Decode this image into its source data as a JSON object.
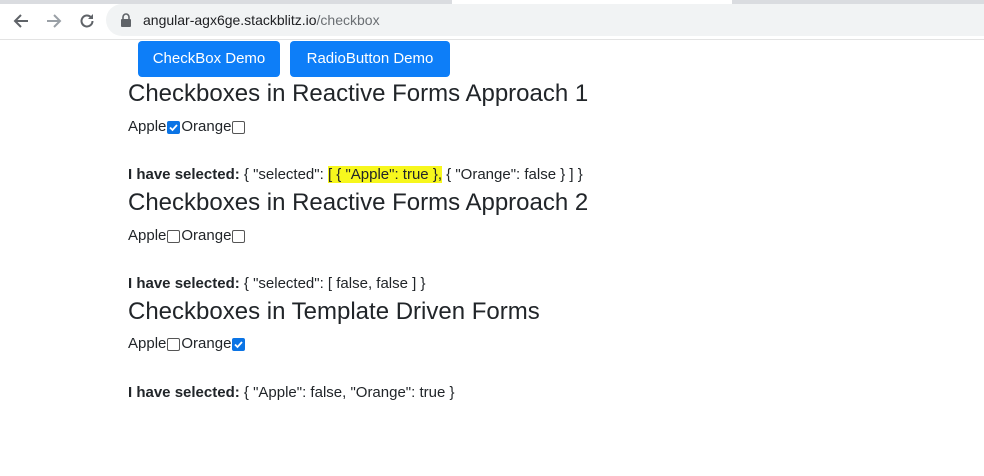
{
  "browser": {
    "url_host": "angular-agx6ge.stackblitz.io",
    "url_path": "/checkbox"
  },
  "nav": {
    "checkbox_demo": "CheckBox Demo",
    "radiobutton_demo": "RadioButton Demo"
  },
  "sections": [
    {
      "title": "Checkboxes in Reactive Forms Approach 1",
      "options": [
        {
          "label": "Apple",
          "checked": true
        },
        {
          "label": "Orange",
          "checked": false
        }
      ],
      "result_label": "I have selected:",
      "result_pre": " { \"selected\": ",
      "result_highlight": "[ { \"Apple\": true },",
      "result_post": " { \"Orange\": false } ] }",
      "highlight_color": "#f7f71d"
    },
    {
      "title": "Checkboxes in Reactive Forms Approach 2",
      "options": [
        {
          "label": "Apple",
          "checked": false
        },
        {
          "label": "Orange",
          "checked": false
        }
      ],
      "result_label": "I have selected:",
      "result_text": " { \"selected\": [ false, false ] }"
    },
    {
      "title": "Checkboxes in Template Driven Forms",
      "options": [
        {
          "label": "Apple",
          "checked": false
        },
        {
          "label": "Orange",
          "checked": true
        }
      ],
      "result_label": "I have selected:",
      "result_text": " { \"Apple\": false, \"Orange\": true }"
    }
  ],
  "colors": {
    "button_bg": "#0d7ef8",
    "checkbox_checked": "#0b74e5",
    "text": "#212529"
  }
}
